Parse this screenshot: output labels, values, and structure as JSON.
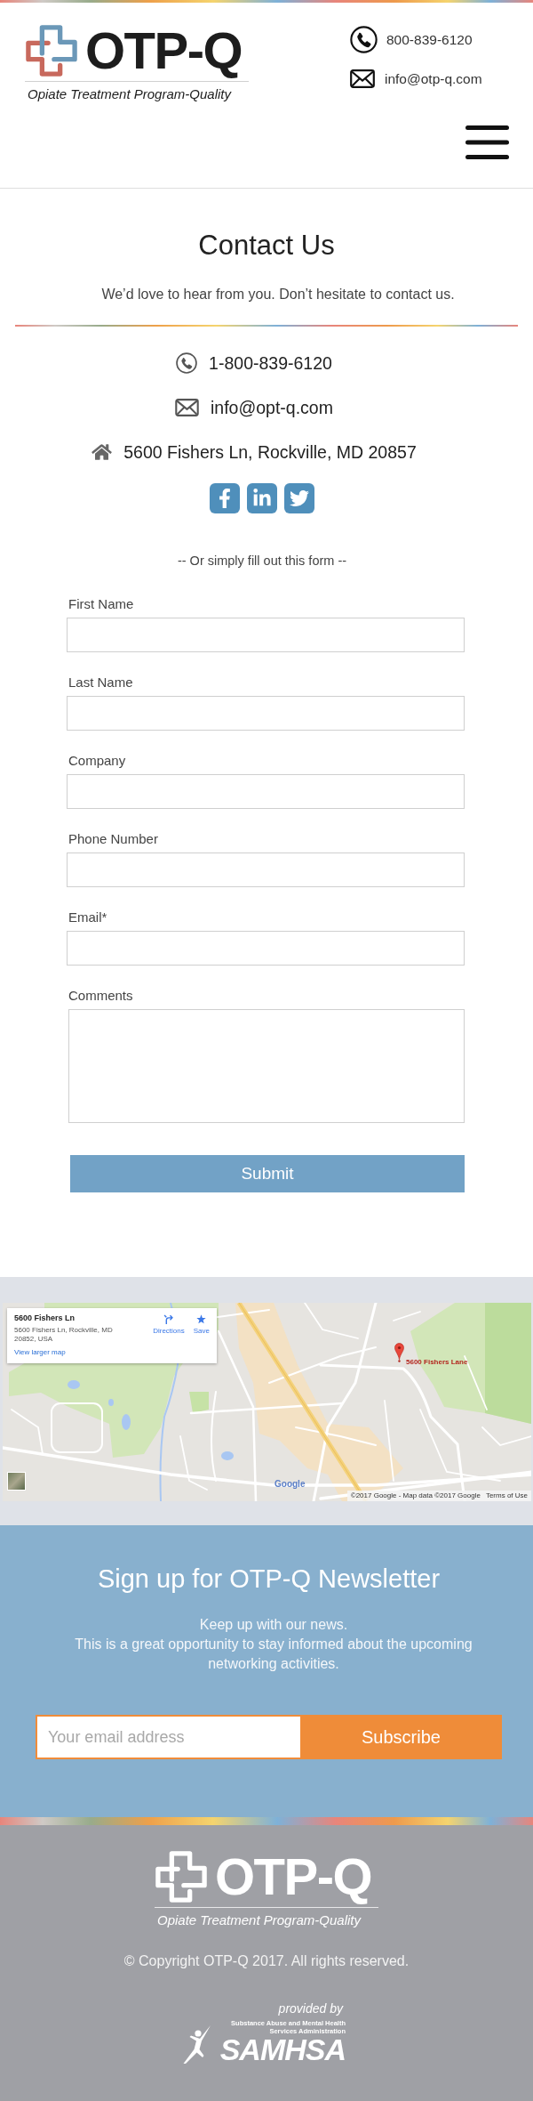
{
  "header": {
    "logo": {
      "wordmark": "OTP-Q",
      "tagline": "Opiate Treatment Program-Quality"
    },
    "contacts": [
      {
        "kind": "phone",
        "text": "800-839-6120"
      },
      {
        "kind": "email",
        "text": "info@otp-q.com"
      }
    ]
  },
  "contact": {
    "title": "Contact Us",
    "subtitle": "We’d love to hear from you. Don’t hesitate to contact us.",
    "items": [
      {
        "kind": "phone",
        "text": "1-800-839-6120"
      },
      {
        "kind": "email",
        "text": "info@opt-q.com"
      },
      {
        "kind": "address",
        "text": "5600 Fishers Ln, Rockville, MD 20857"
      }
    ],
    "form_intro": "-- Or simply fill out this form --"
  },
  "form": {
    "fields": [
      {
        "kind": "text",
        "label": "First Name"
      },
      {
        "kind": "text",
        "label": "Last Name"
      },
      {
        "kind": "text",
        "label": "Company"
      },
      {
        "kind": "text",
        "label": "Phone Number"
      },
      {
        "kind": "text",
        "label": "Email*"
      },
      {
        "kind": "textarea",
        "label": "Comments"
      }
    ],
    "submit": "Submit"
  },
  "map": {
    "card": {
      "title": "5600 Fishers Ln",
      "address": "5600 Fishers Ln, Rockville, MD 20852, USA",
      "actions": [
        {
          "kind": "directions",
          "label": "Directions"
        },
        {
          "kind": "save",
          "label": "Save"
        }
      ],
      "link": "View larger map"
    },
    "marker_label": "5600 Fishers Lane",
    "logo": "Google",
    "attribution": "©2017 Google - Map data ©2017 Google",
    "terms": "Terms of Use"
  },
  "newsletter": {
    "title": "Sign up for OTP-Q Newsletter",
    "lines": [
      "Keep up with our news.",
      "This is a great opportunity to stay informed about the upcoming networking activities."
    ],
    "email_placeholder": "Your email address",
    "button": "Subscribe"
  },
  "footer": {
    "logo": {
      "wordmark": "OTP-Q",
      "tagline": "Opiate Treatment Program-Quality"
    },
    "copyright": "© Copyright OTP-Q 2017. All rights reserved.",
    "provided_by": "provided by",
    "sponsor": {
      "name": "SAMHSA",
      "subtitle": "Substance Abuse and Mental Health Services Administration"
    }
  }
}
